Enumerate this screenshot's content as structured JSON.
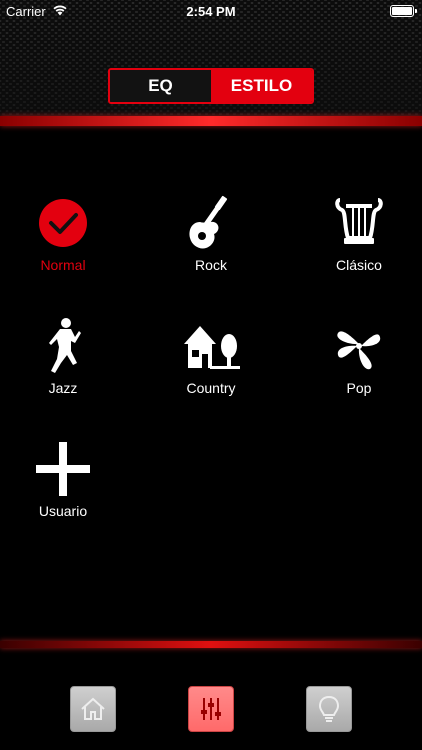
{
  "status_bar": {
    "carrier": "Carrier",
    "time": "2:54 PM",
    "wifi_icon": "wifi-icon",
    "battery_icon": "battery-icon"
  },
  "segment": {
    "eq_label": "EQ",
    "estilo_label": "ESTILO",
    "selected": "ESTILO"
  },
  "styles": [
    {
      "label": "Normal",
      "icon": "checkmark-icon",
      "selected": true
    },
    {
      "label": "Rock",
      "icon": "guitar-icon",
      "selected": false
    },
    {
      "label": "Clásico",
      "icon": "lyre-icon",
      "selected": false
    },
    {
      "label": "Jazz",
      "icon": "singer-icon",
      "selected": false
    },
    {
      "label": "Country",
      "icon": "house-icon",
      "selected": false
    },
    {
      "label": "Pop",
      "icon": "fan-icon",
      "selected": false
    },
    {
      "label": "Usuario",
      "icon": "plus-icon",
      "selected": false
    }
  ],
  "tab_bar": {
    "items": [
      {
        "icon": "home-icon",
        "selected": false
      },
      {
        "icon": "sliders-icon",
        "selected": true
      },
      {
        "icon": "lightbulb-icon",
        "selected": false
      }
    ]
  },
  "colors": {
    "accent": "#e3000f",
    "background": "#000000",
    "text": "#ffffff"
  }
}
